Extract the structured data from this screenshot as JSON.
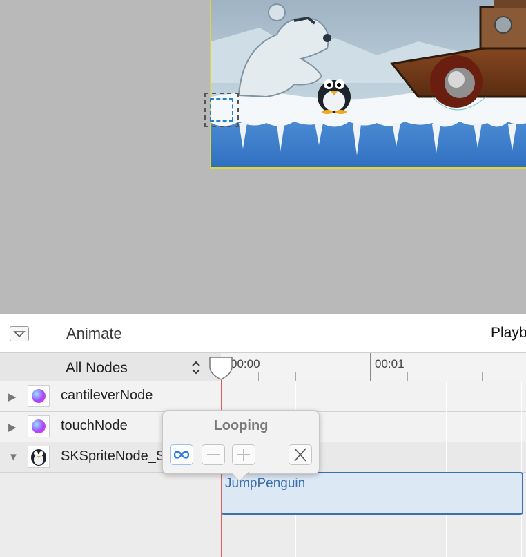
{
  "animate_bar": {
    "title": "Animate",
    "playback_partial": "Playb"
  },
  "timeline": {
    "filter_value": "All Nodes",
    "ruler_labels": [
      "00:00",
      "00:01"
    ]
  },
  "nodes": [
    {
      "label": "cantileverNode",
      "expanded": false,
      "icon": "sphere-icon"
    },
    {
      "label": "touchNode",
      "expanded": false,
      "icon": "sphere-icon"
    },
    {
      "label": "SKSpriteNode_S",
      "expanded": true,
      "icon": "penguin-icon"
    }
  ],
  "action_clip": {
    "label": "JumpPenguin"
  },
  "popover": {
    "title": "Looping",
    "buttons": [
      "infinity-icon",
      "minus-icon",
      "plus-icon",
      "close-icon"
    ]
  },
  "colors": {
    "playhead": "#e25c5c",
    "clip_border": "#3d6fb0",
    "clip_fill": "#dce8f4",
    "scene_border": "#e1d33a",
    "loop_blue": "#2c7be5"
  }
}
